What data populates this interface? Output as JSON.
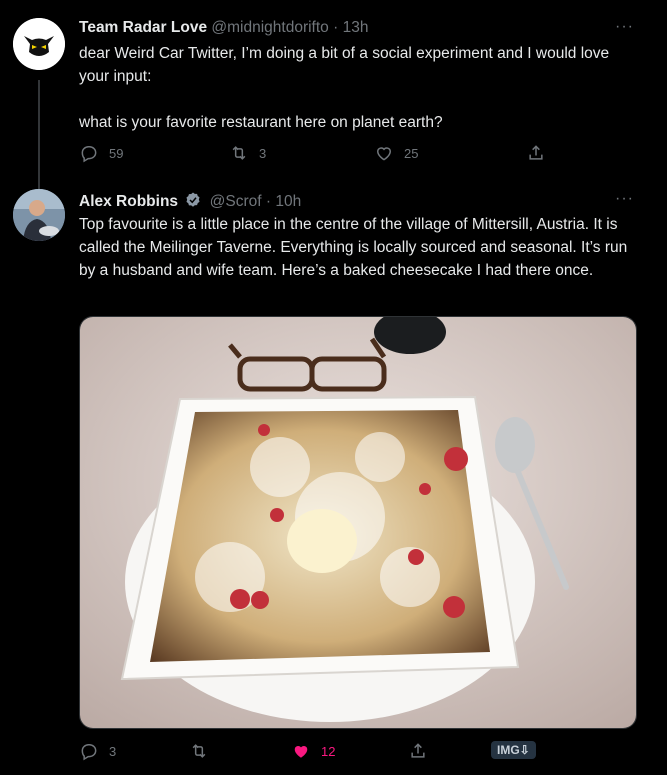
{
  "tweet1": {
    "display_name": "Team Radar Love",
    "handle": "@midnightdorifto",
    "time": "· 13h",
    "more": "···",
    "text": "dear Weird Car Twitter, I’m doing a bit of a social experiment and I would love your input:\n\nwhat is your favorite restaurant here on planet earth?",
    "replies": "59",
    "retweets": "3",
    "likes": "25"
  },
  "tweet2": {
    "display_name": "Alex Robbins",
    "handle": "@Scrof",
    "time": "· 10h",
    "more": "···",
    "text": "Top favourite is a little place in the centre of the village of Mittersill, Austria. It is called the Meilinger Taverne. Everything is locally sourced and seasonal. It’s run by a husband and wife team. Here’s a baked cheesecake I had there once.",
    "replies": "3",
    "retweets": "",
    "likes": "12",
    "badge": "IMG⇩"
  },
  "colors": {
    "background": "#000000",
    "text": "#e7e9ea",
    "muted": "#71767b",
    "like_active": "#f91880",
    "verified": "#8b98a5"
  },
  "icons": [
    "reply-icon",
    "retweet-icon",
    "like-icon",
    "share-icon",
    "verified-icon",
    "more-icon"
  ]
}
